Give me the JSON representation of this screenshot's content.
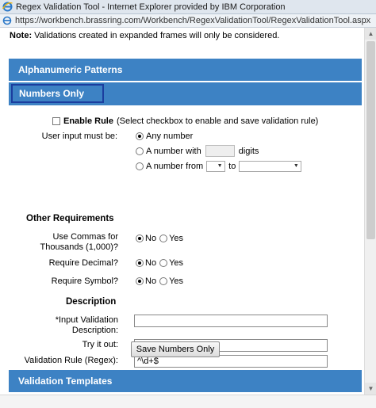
{
  "window": {
    "title": "Regex Validation Tool - Internet Explorer provided by IBM Corporation",
    "url": "https://workbench.brassring.com/Workbench/RegexValidationTool/RegexValidationTool.aspx"
  },
  "note": {
    "label": "Note:",
    "text": " Validations created in expanded frames will only be considered."
  },
  "sections": {
    "alphanumeric": "Alphanumeric Patterns",
    "numbers_only": "Numbers Only",
    "templates": "Validation Templates"
  },
  "enable_rule": {
    "label": "Enable Rule",
    "hint": "(Select checkbox to enable and save validation rule)"
  },
  "user_input": {
    "label": "User input must be:",
    "options": {
      "any": "Any number",
      "with_prefix": "A number with",
      "with_suffix": "digits",
      "from_prefix": "A number from",
      "from_to": "to"
    },
    "selected": "Any number"
  },
  "other_requirements": {
    "heading": "Other Requirements",
    "commas_label_1": "Use Commas for",
    "commas_label_2": "Thousands (1,000)?",
    "decimal_label": "Require Decimal?",
    "symbol_label": "Require Symbol?",
    "no_label": "No",
    "yes_label": "Yes"
  },
  "description": {
    "heading": "Description",
    "input_label_1": "*Input Validation",
    "input_label_2": "Description:",
    "input_value": "",
    "try_label": "Try it out:",
    "try_value": "",
    "regex_label": "Validation Rule (Regex):",
    "regex_value": "^\\d+$"
  },
  "save_button": "Save Numbers Only",
  "colors": {
    "section_bar": "#3d82c4",
    "focus_border": "#1b3d9e"
  }
}
